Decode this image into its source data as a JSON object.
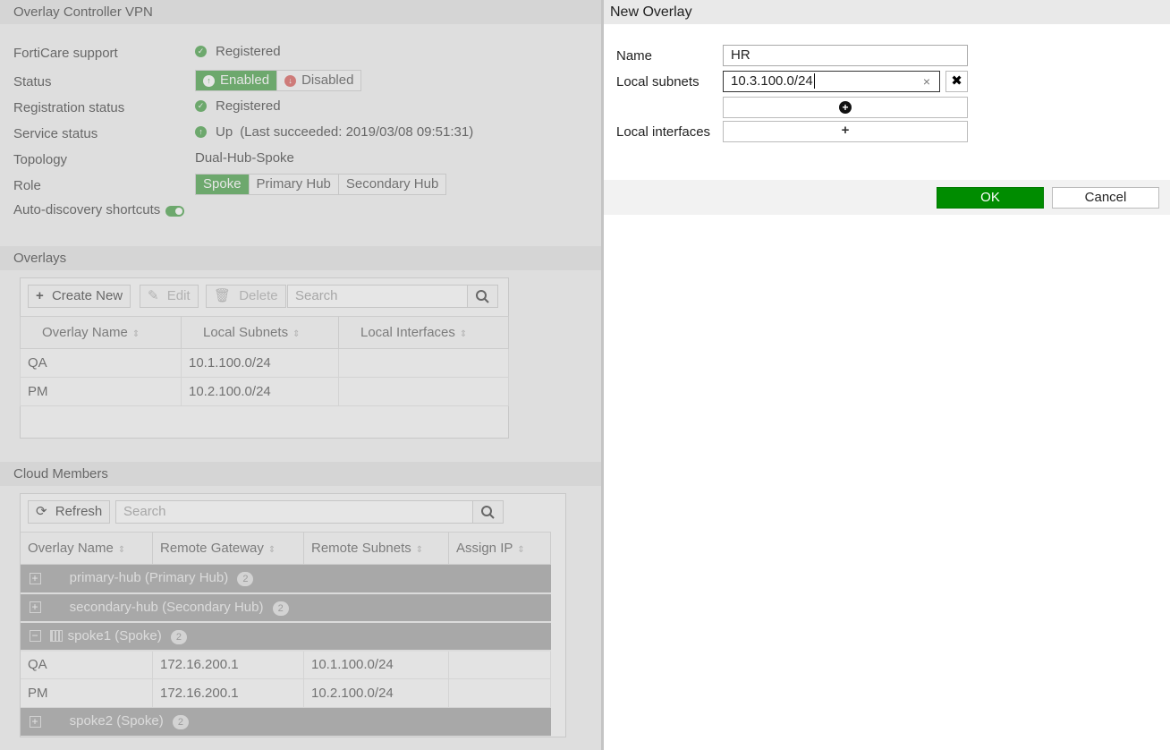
{
  "left": {
    "section_title": "Overlay Controller VPN",
    "forticare": {
      "label": "FortiCare support",
      "value": "Registered"
    },
    "status": {
      "label": "Status",
      "enabled": "Enabled",
      "disabled": "Disabled"
    },
    "registration": {
      "label": "Registration status",
      "value": "Registered"
    },
    "service": {
      "label": "Service status",
      "value": "Up",
      "detail": "(Last succeeded: 2019/03/08 09:51:31)"
    },
    "topology": {
      "label": "Topology",
      "value": "Dual-Hub-Spoke"
    },
    "role": {
      "label": "Role",
      "options": [
        "Spoke",
        "Primary Hub",
        "Secondary Hub"
      ],
      "selected": "Spoke"
    },
    "auto_discovery": {
      "label": "Auto-discovery shortcuts",
      "enabled": true
    },
    "overlays": {
      "section_title": "Overlays",
      "create_new": "Create New",
      "edit": "Edit",
      "delete": "Delete",
      "search_placeholder": "Search",
      "columns": [
        "Overlay Name",
        "Local Subnets",
        "Local Interfaces"
      ],
      "rows": [
        {
          "name": "QA",
          "subnets": "10.1.100.0/24",
          "interfaces": ""
        },
        {
          "name": "PM",
          "subnets": "10.2.100.0/24",
          "interfaces": ""
        }
      ]
    },
    "cloud": {
      "section_title": "Cloud Members",
      "refresh": "Refresh",
      "search_placeholder": "Search",
      "columns": [
        "Overlay Name",
        "Remote Gateway",
        "Remote Subnets",
        "Assign IP"
      ],
      "groups": [
        {
          "name": "primary-hub (Primary Hub)",
          "count": "2",
          "expanded": false
        },
        {
          "name": "secondary-hub (Secondary Hub)",
          "count": "2",
          "expanded": false
        },
        {
          "name": "spoke1 (Spoke)",
          "count": "2",
          "expanded": true,
          "rows": [
            {
              "name": "QA",
              "gateway": "172.16.200.1",
              "subnets": "10.1.100.0/24",
              "assign_ip": ""
            },
            {
              "name": "PM",
              "gateway": "172.16.200.1",
              "subnets": "10.2.100.0/24",
              "assign_ip": ""
            }
          ]
        },
        {
          "name": "spoke2 (Spoke)",
          "count": "2",
          "expanded": false
        }
      ]
    }
  },
  "dialog": {
    "title": "New Overlay",
    "name_label": "Name",
    "name_value": "HR",
    "subnets_label": "Local subnets",
    "subnet_value": "10.3.100.0/24",
    "interfaces_label": "Local interfaces",
    "ok": "OK",
    "cancel": "Cancel"
  },
  "colors": {
    "accent_green": "#3c9c3c",
    "ok_button": "#008c00",
    "group_row": "#9c9c9c"
  }
}
